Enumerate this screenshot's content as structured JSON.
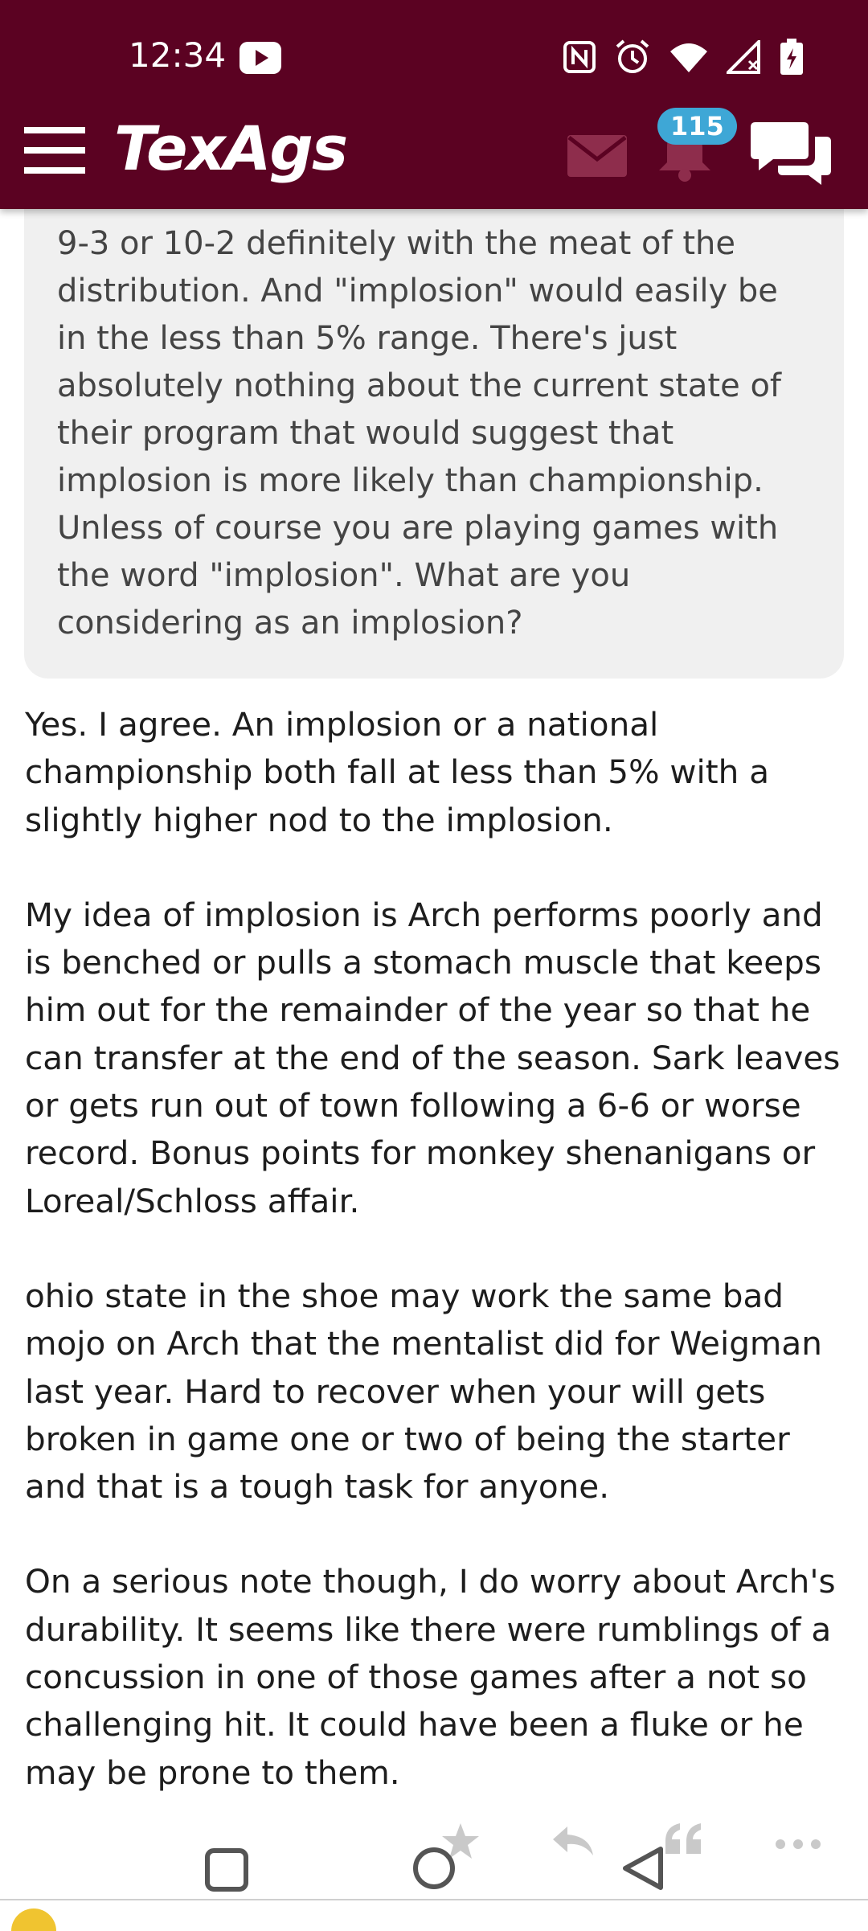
{
  "status_bar": {
    "time": "12:34",
    "icons": [
      "youtube-icon",
      "nfc-icon",
      "alarm-icon",
      "wifi-icon",
      "signal-icon",
      "battery-icon"
    ]
  },
  "header": {
    "logo": "TexAgs",
    "notification_count": "115",
    "icons": [
      "menu-icon",
      "mail-icon",
      "bell-icon",
      "chat-icon"
    ],
    "colors": {
      "bar": "#5b0222",
      "badge": "#3ea7d6"
    }
  },
  "quote": {
    "text": "9-3 or 10-2 definitely with the meat of the\ndistribution. And \"implosion\" would easily be\nin the less than 5% range. There's just\nabsolutely nothing about the current state of\ntheir program that would suggest that\nimplosion is more likely than championship.\nUnless of course you are playing games with\nthe word \"implosion\". What are you\nconsidering as an implosion?"
  },
  "post": {
    "paragraphs": [
      "Yes. I agree. An implosion or a national\nchampionship both fall at less than 5% with a\nslightly higher nod to the implosion.",
      "My idea of implosion is Arch performs poorly and\nis benched or pulls a stomach muscle that keeps\nhim out for the remainder of the year so that he\ncan transfer at the end of the season. Sark leaves\nor gets run out of town following a 6-6 or worse\nrecord. Bonus points for monkey shenanigans or\nLoreal/Schloss affair.",
      "ohio state in the shoe may work the same bad\nmojo on Arch that the mentalist did for Weigman\nlast year. Hard to recover when your will gets\nbroken in game one or two of being the starter\nand that is a tough task for anyone.",
      "On a serious note though, I do worry about Arch's\ndurability. It seems like there were rumblings of a\nconcussion in one of those games after a not so\nchallenging hit. It could have been a fluke or he\nmay be prone to them."
    ]
  },
  "actions": {
    "icons": [
      "star-icon",
      "reply-icon",
      "quote-icon",
      "more-icon"
    ]
  },
  "nav": {
    "icons": [
      "recents-square-icon",
      "home-circle-icon",
      "back-triangle-icon"
    ]
  }
}
